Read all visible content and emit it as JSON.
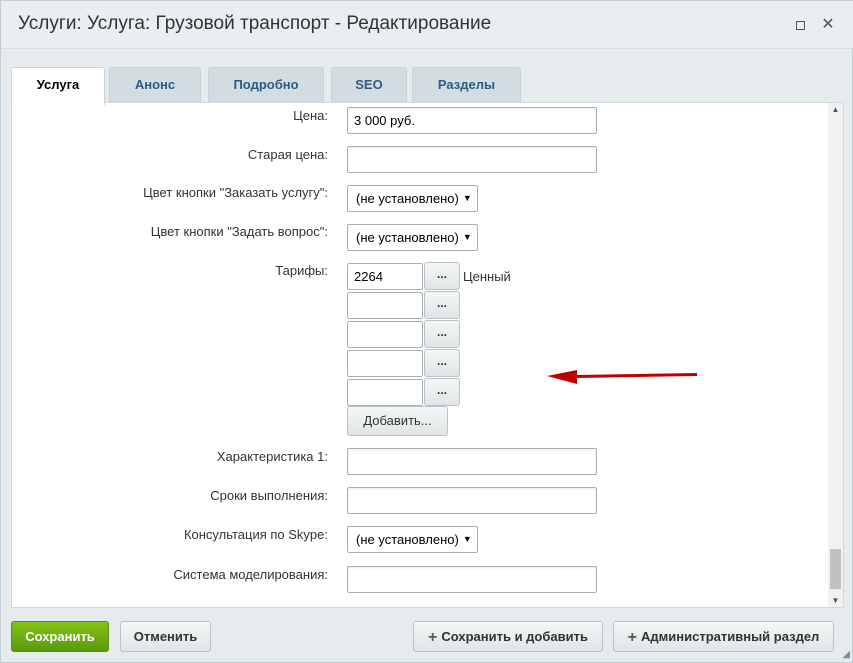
{
  "window": {
    "title": "Услуги: Услуга: Грузовой транспорт - Редактирование"
  },
  "tabs": [
    {
      "label": "Услуга",
      "active": true
    },
    {
      "label": "Анонс",
      "active": false
    },
    {
      "label": "Подробно",
      "active": false
    },
    {
      "label": "SEO",
      "active": false
    },
    {
      "label": "Разделы",
      "active": false
    }
  ],
  "form": {
    "price": {
      "label": "Цена:",
      "value": "3 000 руб."
    },
    "old_price": {
      "label": "Старая цена:",
      "value": ""
    },
    "order_button_color": {
      "label": "Цвет кнопки \"Заказать услугу\":",
      "value": "(не установлено)"
    },
    "ask_button_color": {
      "label": "Цвет кнопки \"Задать вопрос\":",
      "value": "(не установлено)"
    },
    "tariffs": {
      "label": "Тарифы:",
      "items": [
        {
          "value": "2264",
          "name": "Ценный"
        },
        {
          "value": "",
          "name": ""
        },
        {
          "value": "",
          "name": ""
        },
        {
          "value": "",
          "name": ""
        },
        {
          "value": "",
          "name": ""
        }
      ],
      "dots_label": "...",
      "add_label": "Добавить..."
    },
    "characteristic1": {
      "label": "Характеристика 1:",
      "value": ""
    },
    "deadline": {
      "label": "Сроки выполнения:",
      "value": ""
    },
    "skype": {
      "label": "Консультация по Skype:",
      "value": "(не установлено)"
    },
    "modeling": {
      "label": "Система моделирования:",
      "value": ""
    }
  },
  "footer": {
    "save_label": "Сохранить",
    "cancel_label": "Отменить",
    "save_add_label": "Сохранить и добавить",
    "admin_label": "Административный раздел"
  },
  "colors": {
    "accent_arrow": "#c00000",
    "save_button": "#6aab10",
    "tab_text": "#2e5b84"
  },
  "icons": {
    "maximize": "square-icon",
    "close": "close-icon",
    "plus": "plus-icon"
  }
}
